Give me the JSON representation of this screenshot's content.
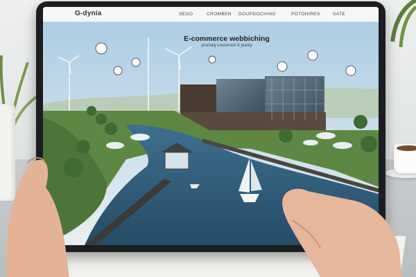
{
  "site": {
    "logo": "G-dynia",
    "nav": [
      "SEGO",
      "CROMBEN",
      "DOUPDOCHING",
      "POTOHIRES",
      "SATE"
    ],
    "headline": "E-commerce webbiching",
    "subline": "promaty costomed G jeanty"
  },
  "icons": [
    "map-pin-icon",
    "shopping-cart-icon",
    "location-icon",
    "search-icon",
    "wifi-icon",
    "chart-icon",
    "phone-icon"
  ],
  "colors": {
    "sky_top": "#a9cbe3",
    "water": "#2f5d7c",
    "greenery": "#4f7a3a",
    "building_glass": "#4d5f6e",
    "tablet_bezel": "#1b1d20",
    "umbrella": "#e9f0f5"
  }
}
